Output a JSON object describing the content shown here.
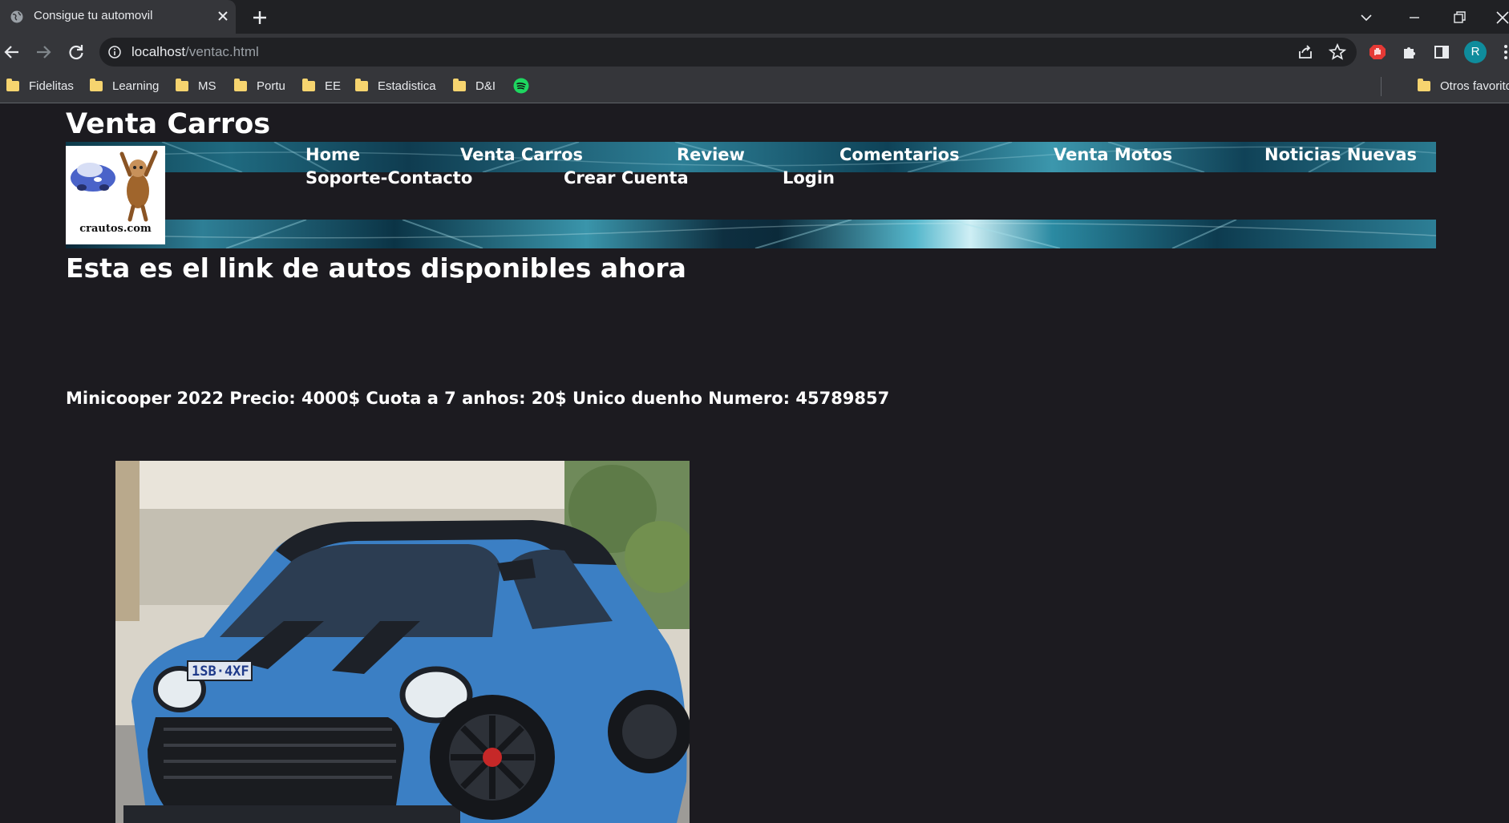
{
  "browser": {
    "tab_title": "Consigue tu automovil",
    "url_host": "localhost",
    "url_path": "/ventac.html",
    "profile_initial": "R",
    "bookmarks": [
      "Fidelitas",
      "Learning",
      "MS",
      "Portu",
      "EE",
      "Estadistica",
      "D&I"
    ],
    "other_bookmarks": "Otros favoritos"
  },
  "site": {
    "title": "Venta Carros",
    "logo_text": "crautos.com",
    "nav": [
      "Home",
      "Venta Carros",
      "Review",
      "Comentarios",
      "Venta Motos",
      "Noticias Nuevas",
      "Soporte-Contacto",
      "Crear Cuenta",
      "Login"
    ]
  },
  "main": {
    "heading": "Esta es el link de autos disponibles ahora",
    "listing": "Minicooper 2022 Precio: 4000$ Cuota a 7 anhos: 20$ Unico duenho Numero: 45789857",
    "plate": "1SB·4XF"
  },
  "colors": {
    "page_bg": "#1c1b20",
    "car_blue": "#3b7fc4",
    "banner_teal": "#2d7f96"
  }
}
